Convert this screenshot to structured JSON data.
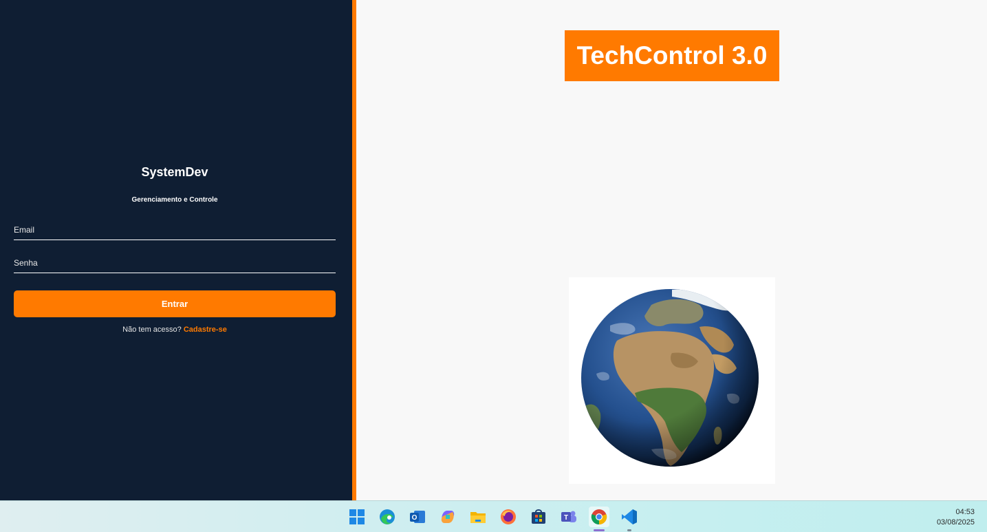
{
  "login": {
    "brand": "SystemDev",
    "tagline": "Gerenciamento e Controle",
    "email_placeholder": "Email",
    "password_placeholder": "Senha",
    "submit_label": "Entrar",
    "signup_prompt": "Não tem acesso?",
    "signup_link": "Cadastre-se"
  },
  "hero": {
    "title": "TechControl 3.0"
  },
  "colors": {
    "accent": "#ff7a00",
    "panel": "#0f1e33"
  },
  "taskbar": {
    "apps": [
      "windows-start-icon",
      "edge-icon",
      "outlook-icon",
      "copilot-icon",
      "file-explorer-icon",
      "firefox-icon",
      "microsoft-store-icon",
      "teams-icon",
      "chrome-icon",
      "vscode-icon"
    ],
    "time": "04:53",
    "date": "03/08/2025"
  }
}
